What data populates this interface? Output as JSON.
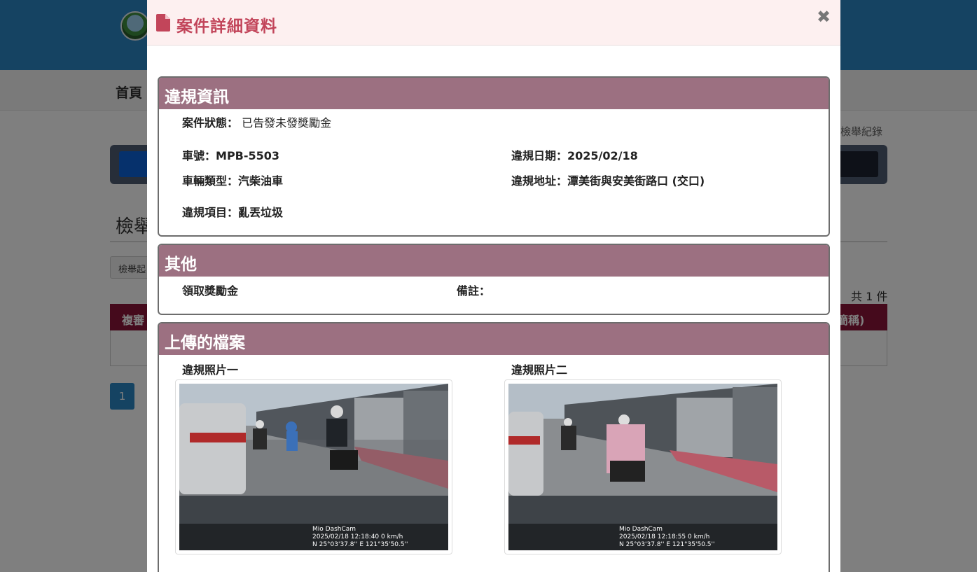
{
  "background": {
    "nav_home": "首頁",
    "record_link": "檢舉紀錄",
    "page_title": "檢舉",
    "filter_button": "檢舉起",
    "total_count": "共 1 件",
    "table_header_left": "複審",
    "table_header_right": "簡稱)",
    "pagination_current": "1",
    "header_color": "#2a86c4",
    "table_header_color": "#8a1538"
  },
  "modal": {
    "title": "案件詳細資料",
    "title_icon": "document-icon",
    "close_icon": "close-icon",
    "close_glyph": "✖",
    "accent_color": "#c2455a",
    "panel_color": "#9c7081"
  },
  "violation_info": {
    "heading": "違規資訊",
    "case_status_label": "案件狀態：",
    "case_status_value": "已告發未發獎勵金",
    "plate_label": "車號：",
    "plate_value": "MPB-5503",
    "date_label": "違規日期：",
    "date_value": "2025/02/18",
    "vehicle_type_label": "車輛類型：",
    "vehicle_type_value": "汽柴油車",
    "address_label": "違規地址：",
    "address_value": "潭美街與安美街路口 (交口)",
    "item_label": "違規項目：",
    "item_value": "亂丟垃圾"
  },
  "other": {
    "heading": "其他",
    "reward_label": "領取獎勵金",
    "remark_label": "備註："
  },
  "uploads": {
    "heading": "上傳的檔案",
    "photos": [
      {
        "label": "違規照片一",
        "brand": "Mio DashCam",
        "timestamp": "2025/02/18 12:18:40  0 km/h",
        "gps": "N 25°03'37.8''    E 121°35'50.5''"
      },
      {
        "label": "違規照片二",
        "brand": "Mio DashCam",
        "timestamp": "2025/02/18 12:18:55  0 km/h",
        "gps": "N 25°03'37.8''    E 121°35'50.5''"
      }
    ]
  }
}
